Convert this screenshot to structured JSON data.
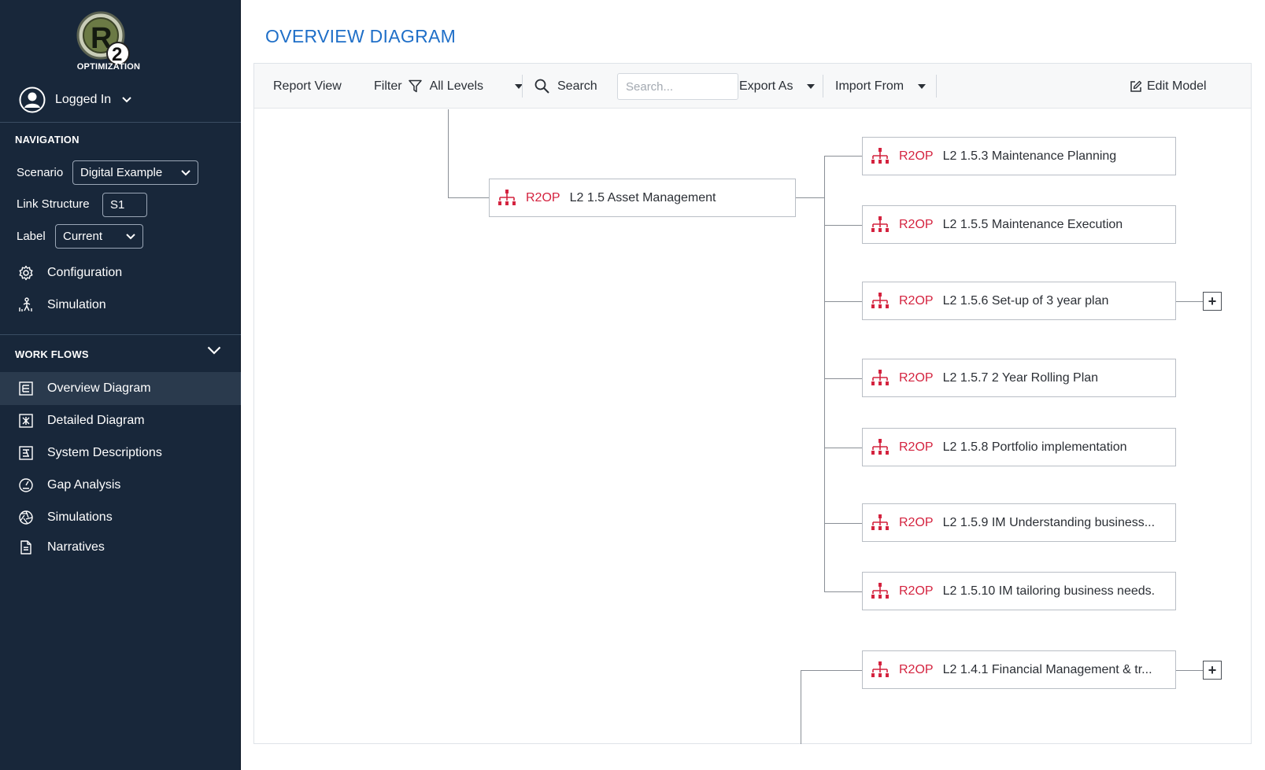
{
  "colors": {
    "sidebar_bg": "#18273a",
    "accent_title": "#1f6fc8",
    "node_code": "#d4233f"
  },
  "sidebar": {
    "logo_text": "OPTIMIZATION",
    "user": {
      "name": "Logged In"
    },
    "navigation": {
      "heading": "NAVIGATION",
      "scenario_label": "Scenario",
      "scenario_value": "Digital Example",
      "link_structure_label": "Link Structure",
      "link_structure_value": "S1",
      "label_label": "Label",
      "label_value": "Current",
      "items": [
        {
          "label": "Configuration",
          "icon": "gear-icon"
        },
        {
          "label": "Simulation",
          "icon": "person-chart-icon"
        }
      ]
    },
    "workflows": {
      "heading": "WORK FLOWS",
      "items": [
        {
          "label": "Overview Diagram",
          "icon": "overview-diagram-icon",
          "active": true
        },
        {
          "label": "Detailed Diagram",
          "icon": "detailed-diagram-icon",
          "active": false
        },
        {
          "label": "System Descriptions",
          "icon": "system-descriptions-icon",
          "active": false
        },
        {
          "label": "Gap Analysis",
          "icon": "gauge-icon",
          "active": false
        },
        {
          "label": "Simulations",
          "icon": "aperture-icon",
          "active": false
        },
        {
          "label": "Narratives",
          "icon": "document-icon",
          "active": false
        }
      ]
    }
  },
  "main": {
    "title": "OVERVIEW DIAGRAM",
    "toolbar": {
      "report_view": "Report View",
      "filter_label": "Filter",
      "filter_value": "All Levels",
      "search_label": "Search",
      "search_placeholder": "Search...",
      "export_label": "Export As",
      "import_label": "Import From",
      "edit_label": "Edit Model"
    },
    "diagram": {
      "parent": {
        "code": "R2OP",
        "title": "L2 1.5 Asset Management"
      },
      "children": [
        {
          "code": "R2OP",
          "title": "L2 1.5.3 Maintenance Planning",
          "expandable": false
        },
        {
          "code": "R2OP",
          "title": "L2 1.5.5 Maintenance Execution",
          "expandable": false
        },
        {
          "code": "R2OP",
          "title": "L2 1.5.6 Set-up of 3 year plan",
          "expandable": true
        },
        {
          "code": "R2OP",
          "title": "L2 1.5.7 2 Year Rolling Plan",
          "expandable": false
        },
        {
          "code": "R2OP",
          "title": "L2 1.5.8 Portfolio implementation",
          "expandable": false
        },
        {
          "code": "R2OP",
          "title": "L2 1.5.9 IM Understanding business...",
          "expandable": false
        },
        {
          "code": "R2OP",
          "title": "L2 1.5.10 IM tailoring business needs.",
          "expandable": false
        }
      ],
      "sibling": {
        "code": "R2OP",
        "title": "L2 1.4.1 Financial Management & tr...",
        "expandable": true
      },
      "expand_symbol": "+"
    }
  }
}
